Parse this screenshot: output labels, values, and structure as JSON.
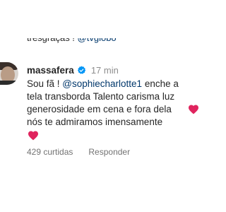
{
  "previous_comment": {
    "text": "tresgraças ! ",
    "mention": "@tvglobo"
  },
  "comment": {
    "username": "massafera",
    "verified_icon": "verified-badge-icon",
    "time_ago": "17 min",
    "text_prefix": "Sou fã ! ",
    "mention": "@sophiecharlotte1",
    "text_line1_rest": " enche a",
    "text_line2": "tela transborda Talento carisma luz",
    "text_line3": "generosidade em cena e fora dela",
    "text_line4": "nós te admiramos imensamente",
    "heart_icon": "red-heart-icon",
    "heart_color": "#e0245e"
  },
  "actions": {
    "likes": "429 curtidas",
    "reply": "Responder"
  },
  "colors": {
    "text": "#262626",
    "secondary": "#737373",
    "mention": "#00376b",
    "verified_blue": "#0095f6"
  }
}
